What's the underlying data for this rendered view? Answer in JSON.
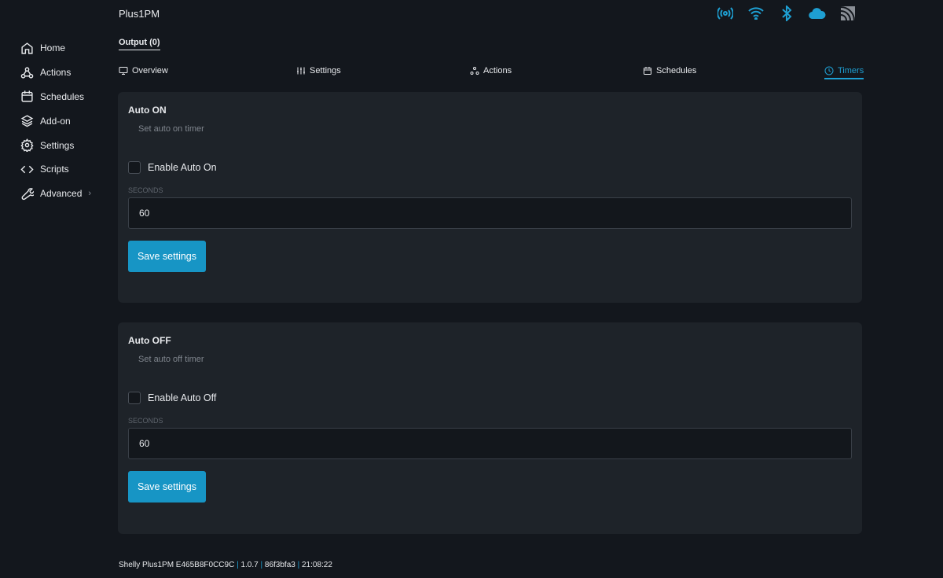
{
  "header": {
    "title": "Plus1PM",
    "status_icons": [
      "ap-broadcast-icon",
      "wifi-icon",
      "bluetooth-icon",
      "cloud-icon",
      "rss-icon"
    ],
    "accent": "#1e9fd2"
  },
  "sidebar": {
    "items": [
      {
        "label": "Home"
      },
      {
        "label": "Actions"
      },
      {
        "label": "Schedules"
      },
      {
        "label": "Add-on"
      },
      {
        "label": "Settings"
      },
      {
        "label": "Scripts"
      },
      {
        "label": "Advanced"
      }
    ]
  },
  "output_tab": "Output (0)",
  "tabs": [
    {
      "label": "Overview"
    },
    {
      "label": "Settings"
    },
    {
      "label": "Actions"
    },
    {
      "label": "Schedules"
    },
    {
      "label": "Timers",
      "active": true
    }
  ],
  "cards": [
    {
      "title": "Auto ON",
      "description": "Set auto on timer",
      "checkbox_label": "Enable Auto On",
      "checked": false,
      "field_label": "SECONDS",
      "value": "60",
      "button": "Save settings"
    },
    {
      "title": "Auto OFF",
      "description": "Set auto off timer",
      "checkbox_label": "Enable Auto Off",
      "checked": false,
      "field_label": "SECONDS",
      "value": "60",
      "button": "Save settings"
    }
  ],
  "footer": {
    "device": "Shelly Plus1PM E465B8F0CC9C",
    "version": "1.0.7",
    "build": "86f3bfa3",
    "time": "21:08:22"
  }
}
